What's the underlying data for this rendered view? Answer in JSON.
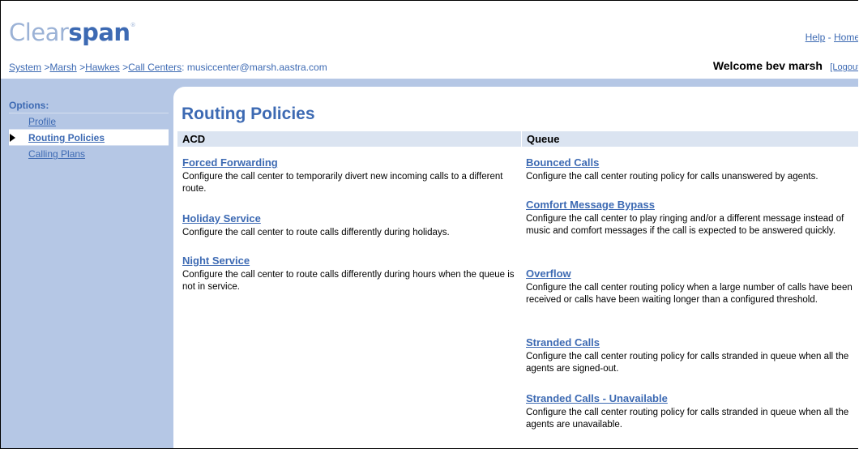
{
  "logo": {
    "part1": "Clear",
    "part2": "span",
    "mark": "®"
  },
  "top_links": {
    "help": "Help",
    "sep": "-",
    "home": "Home"
  },
  "breadcrumb": {
    "system": "System",
    "marsh": "Marsh",
    "hawkes": "Hawkes",
    "call_centers": "Call Centers",
    "separator": ">",
    "current": ": musiccenter@marsh.aastra.com"
  },
  "welcome": {
    "text": "Welcome bev marsh",
    "logout": "[Logout"
  },
  "sidebar": {
    "options_label": "Options:",
    "items": [
      {
        "label": "Profile",
        "active": false
      },
      {
        "label": "Routing Policies",
        "active": true
      },
      {
        "label": "Calling Plans",
        "active": false
      }
    ]
  },
  "page": {
    "title": "Routing Policies"
  },
  "acd": {
    "header": "ACD",
    "entries": [
      {
        "title": "Forced Forwarding",
        "desc": "Configure the call center to temporarily divert new incoming calls to a different route."
      },
      {
        "title": "Holiday Service",
        "desc": "Configure the call center to route calls differently during holidays."
      },
      {
        "title": "Night Service",
        "desc": "Configure the call center to route calls differently during hours when the queue is not in service."
      }
    ]
  },
  "queue": {
    "header": "Queue",
    "entries": [
      {
        "title": "Bounced Calls",
        "desc": "Configure the call center routing policy for calls unanswered by agents."
      },
      {
        "title": "Comfort Message Bypass",
        "desc": "Configure the call center to play ringing and/or a different message instead of music and comfort messages if the call is expected to be answered quickly."
      },
      {
        "title": "Overflow",
        "desc": "Configure the call center routing policy when a large number of calls have been received or calls have been waiting longer than a configured threshold."
      },
      {
        "title": "Stranded Calls",
        "desc": "Configure the call center routing policy for calls stranded in queue when all the agents are signed-out."
      },
      {
        "title": "Stranded Calls - Unavailable",
        "desc": "Configure the call center routing policy for calls stranded in queue when all the agents are unavailable."
      }
    ]
  }
}
